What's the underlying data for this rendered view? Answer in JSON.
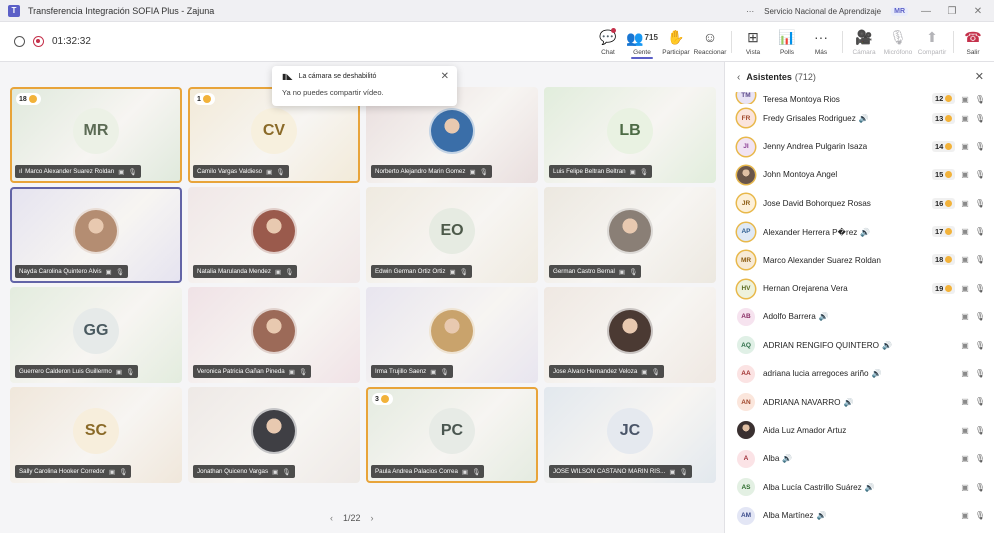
{
  "window": {
    "title": "Transferencia Integración SOFIA Plus - Zajuna",
    "org": "Servicio Nacional de Aprendizaje",
    "org_badge": "MR",
    "more": "···"
  },
  "toolbar": {
    "timer": "01:32:32",
    "buttons": [
      {
        "id": "chat",
        "label": "Chat",
        "icon": "chat-icon",
        "glyph": "💬"
      },
      {
        "id": "people",
        "label": "Gente",
        "icon": "people-icon",
        "glyph": "👥",
        "count": "715"
      },
      {
        "id": "raise-hand",
        "label": "Participar",
        "icon": "raise-hand-icon",
        "glyph": "✋"
      },
      {
        "id": "react",
        "label": "Reaccionar",
        "icon": "smiley-icon",
        "glyph": "☺"
      },
      {
        "id": "view",
        "label": "Vista",
        "icon": "grid-icon",
        "glyph": "⊞"
      },
      {
        "id": "polls",
        "label": "Polls",
        "icon": "polls-icon",
        "glyph": "📊"
      },
      {
        "id": "more",
        "label": "Más",
        "icon": "more-icon",
        "glyph": "···"
      },
      {
        "id": "camera",
        "label": "Cámara",
        "icon": "camera-off-icon",
        "glyph": "🎥"
      },
      {
        "id": "mic",
        "label": "Micrófono",
        "icon": "mic-off-icon",
        "glyph": "🎙"
      },
      {
        "id": "share",
        "label": "Compartir",
        "icon": "share-icon",
        "glyph": "⬆"
      },
      {
        "id": "leave",
        "label": "Salir",
        "icon": "phone-hangup-icon",
        "glyph": "☎"
      }
    ]
  },
  "toast": {
    "title": "La cámara se deshabilitó",
    "message": "Ya no puedes compartir vídeo.",
    "close": "✕"
  },
  "tiles": [
    {
      "name": "Marco Alexander Suarez Roldan",
      "initials": "MR",
      "hand": "18",
      "prefix": "ıl",
      "bg": "#dfe9dc",
      "avbg": "#ecf1e6",
      "avfg": "#5c6b55"
    },
    {
      "name": "Camilo Vargas Valdieso",
      "initials": "CV",
      "hand": "1",
      "bg": "#f2ead8",
      "avbg": "#f7f0de",
      "avfg": "#8a6a28"
    },
    {
      "name": "Norberto Alejandro Marin Gomez",
      "initials": "",
      "photo": "#3a6ea8",
      "bg": "#e9dede"
    },
    {
      "name": "Luis Felipe Beltran Beltran",
      "initials": "LB",
      "bg": "#e1eddc",
      "avbg": "#e9f2e2",
      "avfg": "#4d6b45"
    },
    {
      "name": "Nayda Carolina Quintero Alvis",
      "initials": "",
      "photo": "#b48d72",
      "bg": "#e5e3f0"
    },
    {
      "name": "Natalia Marulanda Mendez",
      "initials": "",
      "photo": "#9a5a4c",
      "bg": "#f0e7e7"
    },
    {
      "name": "Edwin German Ortiz Ortiz",
      "initials": "EO",
      "bg": "#efeae0",
      "avbg": "#e6ebe2",
      "avfg": "#4d5a4a"
    },
    {
      "name": "German Castro Bernal",
      "initials": "",
      "photo": "#8a7f76",
      "bg": "#ece8e0"
    },
    {
      "name": "Guerrero Calderon Luis Guillermo",
      "initials": "GG",
      "bg": "#e3ecde",
      "avbg": "#e6eae9",
      "avfg": "#4a5a60"
    },
    {
      "name": "Veronica Patricia Gañan Pineda",
      "initials": "",
      "photo": "#9c6a58",
      "bg": "#f0e2e6"
    },
    {
      "name": "Irma Trujillo Saenz",
      "initials": "",
      "photo": "#c9a36c",
      "bg": "#e8e5ef"
    },
    {
      "name": "Jose Alvaro Hernandez Veloza",
      "initials": "",
      "photo": "#4b3a33",
      "bg": "#efe8e2"
    },
    {
      "name": "Sally Carolina Hooker Corredor",
      "initials": "SC",
      "bg": "#f0e7db",
      "avbg": "#f7eedc",
      "avfg": "#8a6a28"
    },
    {
      "name": "Jonathan Quiceno Vargas",
      "initials": "",
      "photo": "#3f3f44",
      "bg": "#eee9e6"
    },
    {
      "name": "Paula Andrea Palacios Correa",
      "initials": "PC",
      "hand": "3",
      "bg": "#e4ebe0",
      "avbg": "#e7ebe6",
      "avfg": "#4a5650"
    },
    {
      "name": "JOSE WILSON CASTANO MARIN RIS...",
      "initials": "JC",
      "bg": "#e2e8ee",
      "avbg": "#e5e9ef",
      "avfg": "#4a5568"
    }
  ],
  "pager": {
    "label": "1/22",
    "prev": "‹",
    "next": "›"
  },
  "panel": {
    "title": "Asistentes",
    "count": "(712)",
    "back": "‹",
    "close": "✕",
    "rows": [
      {
        "name": "Teresa Montoya Rios",
        "initials": "TM",
        "hand": "12",
        "bg": "#e9e4f5",
        "fg": "#5b4a8a",
        "ring": true
      },
      {
        "name": "Fredy Grisales Rodriguez",
        "initials": "FR",
        "hand": "13",
        "bg": "#fbe4dc",
        "fg": "#a0462a",
        "ring": true,
        "speaking": true
      },
      {
        "name": "Jenny Andrea Pulgarin Isaza",
        "initials": "JI",
        "hand": "14",
        "bg": "#f1e3f3",
        "fg": "#8a3d93",
        "ring": true
      },
      {
        "name": "John Montoya Angel",
        "initials": "",
        "hand": "15",
        "photo": "#6a5548",
        "ring": true
      },
      {
        "name": "Jose David Bohorquez Rosas",
        "initials": "JR",
        "hand": "16",
        "bg": "#fdf0d8",
        "fg": "#8a5a10",
        "ring": true
      },
      {
        "name": "Alexander Herrera P�rez",
        "initials": "AP",
        "hand": "17",
        "bg": "#dfe9f5",
        "fg": "#2f5f92",
        "ring": true,
        "speaking": true
      },
      {
        "name": "Marco Alexander Suarez Roldan",
        "initials": "MR",
        "hand": "18",
        "bg": "#f7ead6",
        "fg": "#8a5a10",
        "ring": true
      },
      {
        "name": "Hernan Orejarena Vera",
        "initials": "HV",
        "hand": "19",
        "bg": "#eef2dc",
        "fg": "#5b6a20",
        "ring": true
      },
      {
        "name": "Adolfo Barrera",
        "initials": "AB",
        "bg": "#f6e3ef",
        "fg": "#8a2f66",
        "speaking": true
      },
      {
        "name": "ADRIAN RENGIFO QUINTERO",
        "initials": "AQ",
        "bg": "#e0f0e6",
        "fg": "#2a6b45",
        "speaking": true
      },
      {
        "name": "adriana lucia arregoces ariño",
        "initials": "AA",
        "bg": "#fbe3e3",
        "fg": "#a03030",
        "speaking": true
      },
      {
        "name": "ADRIANA NAVARRO",
        "initials": "AN",
        "bg": "#fbe6dc",
        "fg": "#a0462a",
        "speaking": true
      },
      {
        "name": "Aida Luz Amador Artuz",
        "initials": "",
        "photo": "#3a3030"
      },
      {
        "name": "Alba",
        "initials": "A",
        "bg": "#fbe3e6",
        "fg": "#a0303a",
        "speaking": true
      },
      {
        "name": "Alba Lucía Castrillo Suárez",
        "initials": "AS",
        "bg": "#e3f0e3",
        "fg": "#2a6b2a",
        "speaking": true
      },
      {
        "name": "Alba Martínez",
        "initials": "AM",
        "bg": "#e3e6f5",
        "fg": "#3a4a8a",
        "speaking": true
      }
    ]
  },
  "icons": {
    "mic": "🎙",
    "cam": "▣",
    "speak": "🔊",
    "hand": "✋"
  }
}
